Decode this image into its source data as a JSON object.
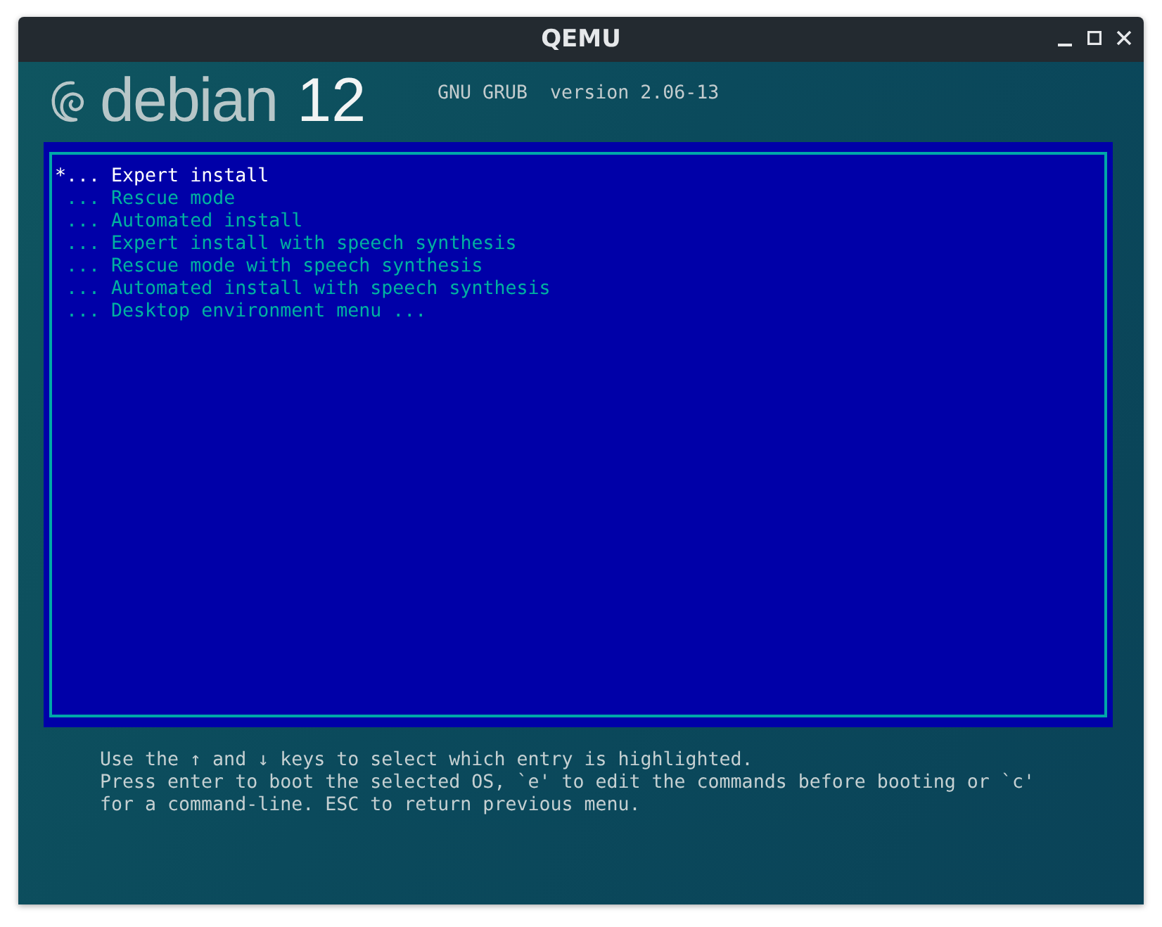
{
  "window": {
    "title": "QEMU"
  },
  "header": {
    "logo_word": "debian",
    "logo_version": "12",
    "grub": "GNU GRUB  version 2.06-13"
  },
  "menu": [
    {
      "marker": "*",
      "prefix": "...",
      "label": "Expert install",
      "selected": true
    },
    {
      "prefix": "...",
      "label": "Rescue mode",
      "selected": false
    },
    {
      "prefix": "...",
      "label": "Automated install",
      "selected": false
    },
    {
      "prefix": "...",
      "label": "Expert install with speech synthesis",
      "selected": false
    },
    {
      "prefix": "...",
      "label": "Rescue mode with speech synthesis",
      "selected": false
    },
    {
      "prefix": "...",
      "label": "Automated install with speech synthesis",
      "selected": false
    },
    {
      "prefix": "...",
      "label": "Desktop environment menu ...",
      "selected": false
    }
  ],
  "help": [
    "Use the ↑ and ↓ keys to select which entry is highlighted.",
    "Press enter to boot the selected OS, `e' to edit the commands before booting or `c'",
    "for a command-line. ESC to return previous menu."
  ]
}
